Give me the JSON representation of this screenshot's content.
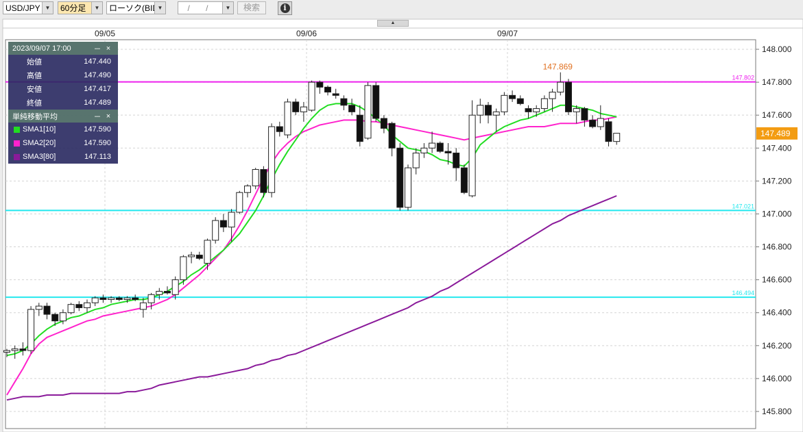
{
  "toolbar": {
    "symbol": "USD/JPY",
    "interval": "60分足",
    "chart_type": "ローソク(BID)",
    "date_placeholder": "/ /",
    "search_label": "検索",
    "info_icon": "info-icon"
  },
  "info_panel": {
    "datetime": "2023/09/07 17:00",
    "minimize": "－",
    "close": "×",
    "ohlc": [
      {
        "label": "始値",
        "value": "147.440"
      },
      {
        "label": "高値",
        "value": "147.490"
      },
      {
        "label": "安値",
        "value": "147.417"
      },
      {
        "label": "終値",
        "value": "147.489"
      }
    ],
    "sma_title": "単純移動平均",
    "sma": [
      {
        "name": "SMA1[10]",
        "value": "147.590",
        "color": "#22dd22"
      },
      {
        "name": "SMA2[20]",
        "value": "147.590",
        "color": "#ff22cc"
      },
      {
        "name": "SMA3[80]",
        "value": "147.113",
        "color": "#8a1a9a"
      }
    ]
  },
  "chart_data": {
    "type": "candlestick",
    "x_labels": [
      "09/05",
      "09/06",
      "09/07"
    ],
    "y_ticks": [
      "148.000",
      "147.800",
      "147.600",
      "147.400",
      "147.200",
      "147.000",
      "146.800",
      "146.600",
      "146.400",
      "146.200",
      "146.000",
      "145.800"
    ],
    "ylim": [
      145.8,
      148.0
    ],
    "current_price": "147.489",
    "high_label": "147.869",
    "hlines": [
      {
        "value": 147.802,
        "label": "147.802",
        "color": "#ee22ee"
      },
      {
        "value": 147.021,
        "label": "147.021",
        "color": "#22e8ee"
      },
      {
        "value": 146.494,
        "label": "146.494",
        "color": "#22e8ee"
      }
    ],
    "candles": [
      [
        146.16,
        146.18,
        146.13,
        146.17
      ],
      [
        146.17,
        146.2,
        146.12,
        146.18
      ],
      [
        146.18,
        146.22,
        146.14,
        146.17
      ],
      [
        146.17,
        146.44,
        146.15,
        146.42
      ],
      [
        146.42,
        146.46,
        146.38,
        146.44
      ],
      [
        146.44,
        146.46,
        146.36,
        146.39
      ],
      [
        146.39,
        146.4,
        146.32,
        146.35
      ],
      [
        146.35,
        146.42,
        146.33,
        146.4
      ],
      [
        146.4,
        146.46,
        146.39,
        146.45
      ],
      [
        146.45,
        146.47,
        146.41,
        146.43
      ],
      [
        146.43,
        146.48,
        146.4,
        146.46
      ],
      [
        146.46,
        146.5,
        146.44,
        146.49
      ],
      [
        146.49,
        146.51,
        146.46,
        146.48
      ],
      [
        146.48,
        146.5,
        146.46,
        146.49
      ],
      [
        146.49,
        146.5,
        146.47,
        146.48
      ],
      [
        146.48,
        146.5,
        146.46,
        146.49
      ],
      [
        146.49,
        146.51,
        146.47,
        146.48
      ],
      [
        146.42,
        146.49,
        146.37,
        146.46
      ],
      [
        146.46,
        146.52,
        146.42,
        146.51
      ],
      [
        146.51,
        146.55,
        146.48,
        146.53
      ],
      [
        146.53,
        146.56,
        146.51,
        146.52
      ],
      [
        146.51,
        146.62,
        146.48,
        146.6
      ],
      [
        146.6,
        146.75,
        146.57,
        146.74
      ],
      [
        146.74,
        146.77,
        146.7,
        146.75
      ],
      [
        146.75,
        146.77,
        146.72,
        146.73
      ],
      [
        146.7,
        146.85,
        146.66,
        146.84
      ],
      [
        146.84,
        146.98,
        146.82,
        146.96
      ],
      [
        146.96,
        147.0,
        146.89,
        146.92
      ],
      [
        146.92,
        147.03,
        146.83,
        147.01
      ],
      [
        147.01,
        147.14,
        147.0,
        147.13
      ],
      [
        147.13,
        147.18,
        147.1,
        147.17
      ],
      [
        147.17,
        147.28,
        147.15,
        147.27
      ],
      [
        147.27,
        147.29,
        147.1,
        147.13
      ],
      [
        147.13,
        147.55,
        147.1,
        147.53
      ],
      [
        147.53,
        147.56,
        147.47,
        147.5
      ],
      [
        147.48,
        147.7,
        147.46,
        147.68
      ],
      [
        147.68,
        147.7,
        147.6,
        147.62
      ],
      [
        147.62,
        147.68,
        147.56,
        147.65
      ],
      [
        147.63,
        147.81,
        147.62,
        147.8
      ],
      [
        147.8,
        147.81,
        147.73,
        147.77
      ],
      [
        147.77,
        147.78,
        147.72,
        147.74
      ],
      [
        147.73,
        147.76,
        147.7,
        147.72
      ],
      [
        147.7,
        147.72,
        147.63,
        147.66
      ],
      [
        147.66,
        147.7,
        147.6,
        147.62
      ],
      [
        147.6,
        147.66,
        147.41,
        147.44
      ],
      [
        147.46,
        147.8,
        147.45,
        147.78
      ],
      [
        147.78,
        147.8,
        147.56,
        147.58
      ],
      [
        147.58,
        147.6,
        147.49,
        147.52
      ],
      [
        147.55,
        147.56,
        147.35,
        147.4
      ],
      [
        147.4,
        147.43,
        147.02,
        147.04
      ],
      [
        147.04,
        147.3,
        147.02,
        147.28
      ],
      [
        147.28,
        147.4,
        147.24,
        147.37
      ],
      [
        147.37,
        147.43,
        147.34,
        147.4
      ],
      [
        147.4,
        147.5,
        147.37,
        147.43
      ],
      [
        147.43,
        147.44,
        147.37,
        147.38
      ],
      [
        147.38,
        147.43,
        147.3,
        147.37
      ],
      [
        147.37,
        147.4,
        147.2,
        147.28
      ],
      [
        147.28,
        147.3,
        147.12,
        147.13
      ],
      [
        147.11,
        147.69,
        147.1,
        147.6
      ],
      [
        147.6,
        147.7,
        147.55,
        147.66
      ],
      [
        147.66,
        147.68,
        147.55,
        147.6
      ],
      [
        147.6,
        147.64,
        147.5,
        147.62
      ],
      [
        147.62,
        147.74,
        147.6,
        147.72
      ],
      [
        147.72,
        147.75,
        147.68,
        147.7
      ],
      [
        147.7,
        147.72,
        147.66,
        147.67
      ],
      [
        147.64,
        147.66,
        147.58,
        147.62
      ],
      [
        147.62,
        147.66,
        147.59,
        147.64
      ],
      [
        147.64,
        147.72,
        147.62,
        147.7
      ],
      [
        147.7,
        147.76,
        147.62,
        147.74
      ],
      [
        147.74,
        147.86,
        147.72,
        147.8
      ],
      [
        147.8,
        147.82,
        147.6,
        147.62
      ],
      [
        147.62,
        147.66,
        147.55,
        147.64
      ],
      [
        147.64,
        147.65,
        147.53,
        147.57
      ],
      [
        147.57,
        147.6,
        147.52,
        147.53
      ],
      [
        147.53,
        147.66,
        147.51,
        147.58
      ],
      [
        147.56,
        147.58,
        147.41,
        147.44
      ],
      [
        147.44,
        147.49,
        147.42,
        147.49
      ]
    ],
    "sma1": [
      146.14,
      146.15,
      146.17,
      146.21,
      146.26,
      146.3,
      146.33,
      146.35,
      146.37,
      146.38,
      146.4,
      146.42,
      146.43,
      146.45,
      146.46,
      146.47,
      146.48,
      146.48,
      146.49,
      146.51,
      146.53,
      146.56,
      146.59,
      146.63,
      146.66,
      146.7,
      146.74,
      146.78,
      146.83,
      146.88,
      146.95,
      147.02,
      147.11,
      147.21,
      147.3,
      147.38,
      147.45,
      147.52,
      147.58,
      147.63,
      147.66,
      147.67,
      147.67,
      147.67,
      147.65,
      147.62,
      147.58,
      147.54,
      147.48,
      147.44,
      147.4,
      147.39,
      147.38,
      147.36,
      147.33,
      147.32,
      147.3,
      147.29,
      147.34,
      147.42,
      147.46,
      147.5,
      147.53,
      147.55,
      147.57,
      147.58,
      147.6,
      147.62,
      147.64,
      147.66,
      147.66,
      147.65,
      147.64,
      147.63,
      147.61,
      147.6,
      147.59
    ],
    "sma2": [
      145.9,
      145.98,
      146.06,
      146.15,
      146.21,
      146.25,
      146.27,
      146.29,
      146.31,
      146.33,
      146.35,
      146.36,
      146.38,
      146.39,
      146.4,
      146.41,
      146.42,
      146.43,
      146.44,
      146.46,
      146.48,
      146.51,
      146.55,
      146.59,
      146.63,
      146.68,
      146.73,
      146.78,
      146.85,
      146.93,
      147.02,
      147.12,
      147.22,
      147.31,
      147.38,
      147.43,
      147.47,
      147.5,
      147.52,
      147.54,
      147.55,
      147.56,
      147.57,
      147.57,
      147.57,
      147.56,
      147.56,
      147.55,
      147.54,
      147.53,
      147.52,
      147.51,
      147.5,
      147.49,
      147.48,
      147.47,
      147.46,
      147.45,
      147.46,
      147.47,
      147.48,
      147.49,
      147.5,
      147.51,
      147.52,
      147.53,
      147.53,
      147.53,
      147.54,
      147.55,
      147.55,
      147.55,
      147.56,
      147.57,
      147.57,
      147.58,
      147.59
    ],
    "sma3": [
      145.87,
      145.88,
      145.89,
      145.89,
      145.89,
      145.9,
      145.9,
      145.9,
      145.91,
      145.91,
      145.91,
      145.91,
      145.91,
      145.91,
      145.91,
      145.92,
      145.92,
      145.93,
      145.94,
      145.96,
      145.97,
      145.98,
      145.99,
      146.0,
      146.01,
      146.01,
      146.02,
      146.03,
      146.04,
      146.05,
      146.06,
      146.08,
      146.09,
      146.11,
      146.12,
      146.14,
      146.15,
      146.17,
      146.19,
      146.21,
      146.23,
      146.25,
      146.27,
      146.29,
      146.31,
      146.33,
      146.35,
      146.37,
      146.39,
      146.41,
      146.43,
      146.46,
      146.48,
      146.5,
      146.53,
      146.55,
      146.58,
      146.61,
      146.64,
      146.67,
      146.7,
      146.73,
      146.76,
      146.79,
      146.82,
      146.85,
      146.88,
      146.91,
      146.94,
      146.96,
      146.99,
      147.01,
      147.03,
      147.05,
      147.07,
      147.09,
      147.11
    ]
  }
}
